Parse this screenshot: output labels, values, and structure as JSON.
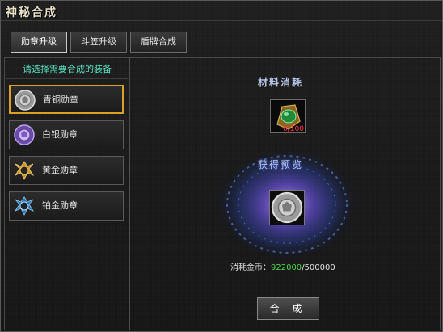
{
  "window": {
    "title": "神秘合成"
  },
  "tabs": [
    {
      "label": "勋章升级",
      "active": true
    },
    {
      "label": "斗笠升级",
      "active": false
    },
    {
      "label": "盾牌合成",
      "active": false
    }
  ],
  "left_panel": {
    "header": "请选择需要合成的装备",
    "items": [
      {
        "label": "青铜勋章",
        "icon": "bronze-medal-icon",
        "selected": true
      },
      {
        "label": "白银勋章",
        "icon": "silver-medal-icon",
        "selected": false
      },
      {
        "label": "黄金勋章",
        "icon": "gold-medal-icon",
        "selected": false
      },
      {
        "label": "铂金勋章",
        "icon": "platinum-medal-icon",
        "selected": false
      }
    ]
  },
  "materials": {
    "title": "材料消耗",
    "item": {
      "icon": "green-gem-amulet-icon",
      "count": "0/100",
      "count_color": "#ff3b3b"
    }
  },
  "preview": {
    "label": "获得预览",
    "icon": "bronze-medal-icon"
  },
  "cost": {
    "label": "消耗金币：",
    "current": "922000",
    "separator": "/",
    "required": "500000",
    "current_color": "#4cd84c"
  },
  "actions": {
    "synthesize_label": "合 成"
  },
  "colors": {
    "selected_border": "#d9a126",
    "header_text": "#58e2c4",
    "glow": "#4d6cff"
  }
}
